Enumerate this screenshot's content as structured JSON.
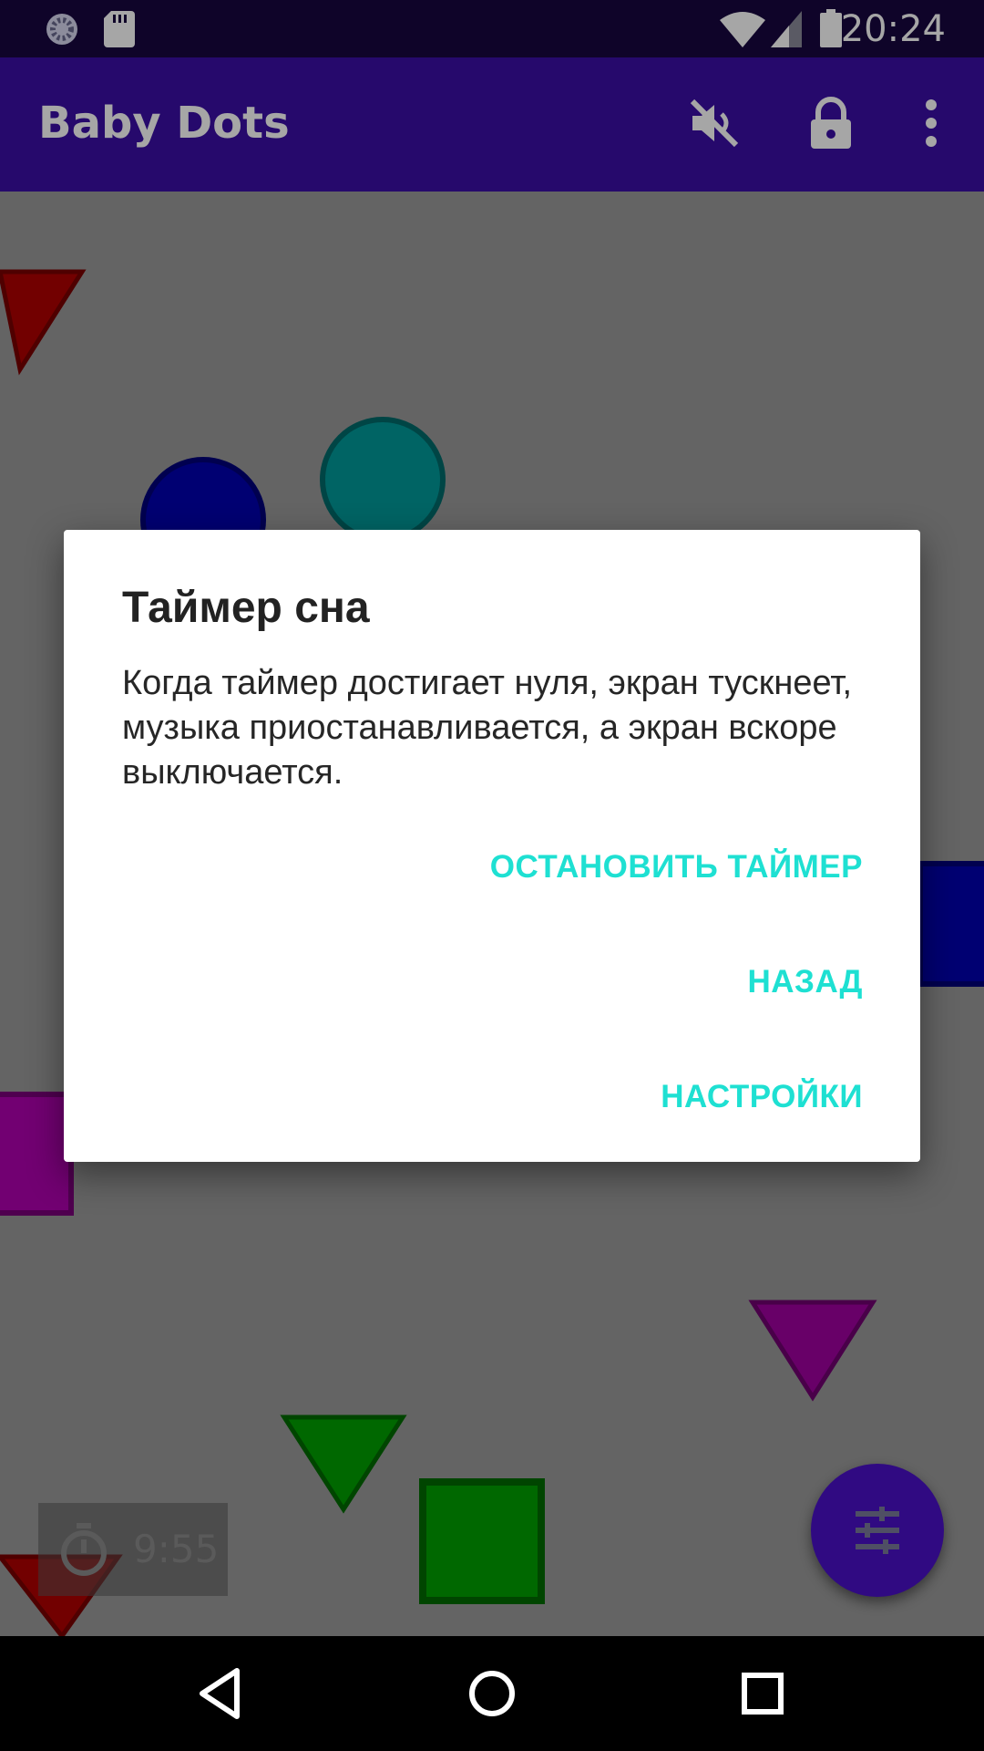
{
  "status_bar": {
    "time": "20:24"
  },
  "app_bar": {
    "title": "Baby Dots"
  },
  "dialog": {
    "title": "Таймер сна",
    "message": "Когда таймер достигает нуля, экран тускнеет, музыка приостанавливается, а экран вскоре выключается.",
    "buttons": [
      "ОСТАНОВИТЬ ТАЙМЕР",
      "НАЗАД",
      "НАСТРОЙКИ"
    ]
  },
  "timer_chip": {
    "remaining": "9:55"
  },
  "colors": {
    "status_bar": "#17073f",
    "app_bar": "#3b0ea6",
    "fab": "#4a10c8",
    "accent": "#1ee0d2",
    "playfield": "#9a9a9a"
  },
  "icons": {
    "status_left": [
      "spinner-icon",
      "sd-card-icon"
    ],
    "status_right": [
      "wifi-icon",
      "signal-icon",
      "battery-icon"
    ],
    "app_bar": [
      "mute-icon",
      "lock-icon",
      "more-vert-icon"
    ],
    "timer": "stopwatch-icon",
    "fab": "tune-icon",
    "navigation": [
      "back-icon",
      "home-icon",
      "recents-icon"
    ]
  }
}
